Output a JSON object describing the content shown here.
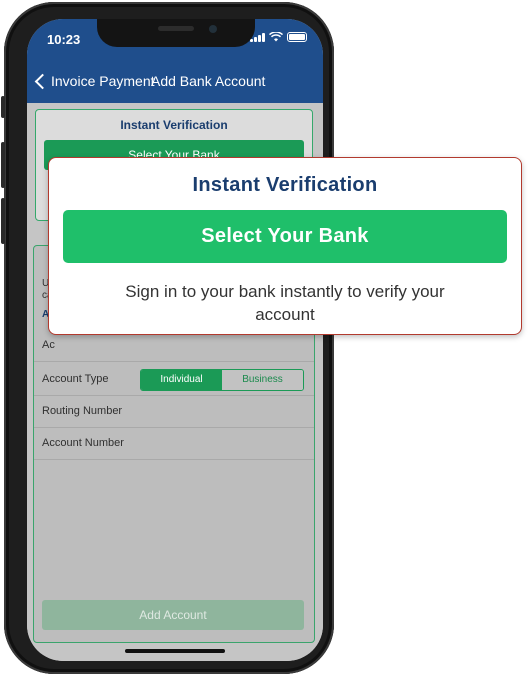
{
  "statusbar": {
    "time": "10:23"
  },
  "navbar": {
    "back_label": "Invoice Payment",
    "title": "Add Bank Account"
  },
  "instant_card": {
    "title": "Instant Verification",
    "button_label": "Select Your Bank"
  },
  "form": {
    "partial_text_line1": "Us",
    "partial_text_line2": "ca",
    "partial_link": "Ac",
    "partial_row": "Ac",
    "account_type_label": "Account Type",
    "account_type_options": [
      "Individual",
      "Business"
    ],
    "account_type_selected": "Individual",
    "routing_label": "Routing Number",
    "account_number_label": "Account Number",
    "add_button_label": "Add Account"
  },
  "callout": {
    "title": "Instant Verification",
    "button_label": "Select Your Bank",
    "description": "Sign in to your bank instantly to verify your account"
  },
  "colors": {
    "nav_blue": "#1f4e8c",
    "accent_green": "#1fbf6a",
    "title_blue": "#1a3d6e",
    "callout_border": "#b23a2e"
  }
}
